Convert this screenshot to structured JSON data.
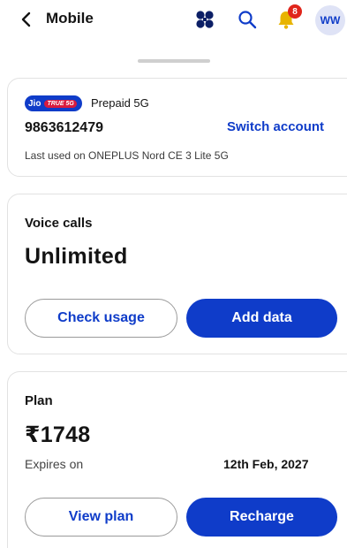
{
  "header": {
    "title": "Mobile",
    "notification_count": "8",
    "avatar_initials": "WW",
    "icons": {
      "back": "chevron-left-icon",
      "apps": "apps-grid-icon",
      "search": "search-icon",
      "bell": "bell-icon"
    }
  },
  "account": {
    "brand_logo": "Jio TRUE 5G",
    "plan_type": "Prepaid 5G",
    "phone_number": "9863612479",
    "switch_label": "Switch account",
    "last_used": "Last used on ONEPLUS Nord CE 3 Lite 5G"
  },
  "voice": {
    "label": "Voice calls",
    "value": "Unlimited",
    "check_usage_label": "Check usage",
    "add_data_label": "Add data"
  },
  "plan": {
    "label": "Plan",
    "price": "₹1748",
    "expires_label": "Expires on",
    "expires_date": "12th Feb, 2027",
    "view_plan_label": "View plan",
    "recharge_label": "Recharge"
  },
  "colors": {
    "accent": "#0f3cc9",
    "badge": "#e0251b",
    "bell": "#e8b400"
  }
}
